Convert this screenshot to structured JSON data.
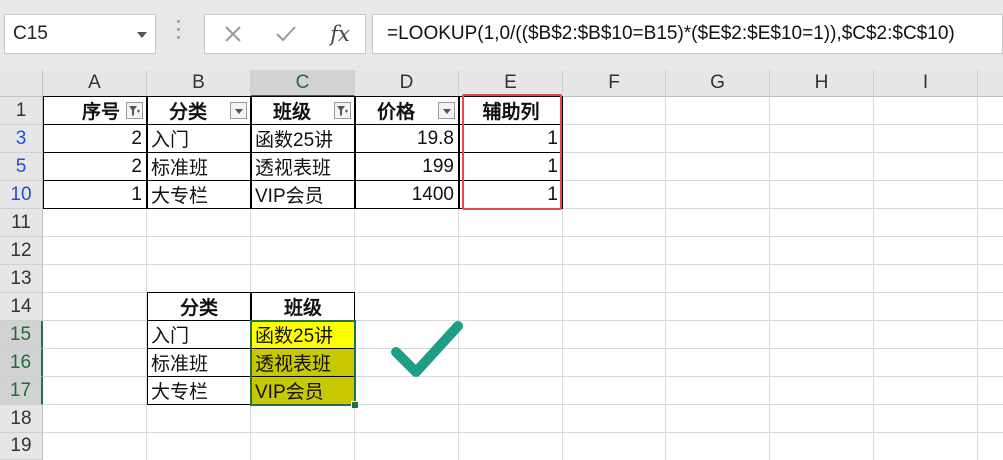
{
  "name_box": {
    "value": "C15"
  },
  "formula_bar": {
    "cancel_icon": "close-icon",
    "enter_icon": "check-icon",
    "fx_label": "fx",
    "formula": "=LOOKUP(1,0/(($B$2:$B$10=B15)*($E$2:$E$10=1)),$C$2:$C$10)"
  },
  "columns": [
    "A",
    "B",
    "C",
    "D",
    "E",
    "F",
    "G",
    "H",
    "I"
  ],
  "rows": [
    "1",
    "3",
    "5",
    "10",
    "11",
    "12",
    "13",
    "14",
    "15",
    "16",
    "17",
    "18",
    "19"
  ],
  "table1": {
    "headers": [
      "序号",
      "分类",
      "班级",
      "价格",
      "辅助列"
    ],
    "rows": [
      [
        "2",
        "入门",
        "函数25讲",
        "19.8",
        "1"
      ],
      [
        "2",
        "标准班",
        "透视表班",
        "199",
        "1"
      ],
      [
        "1",
        "大专栏",
        "VIP会员",
        "1400",
        "1"
      ]
    ]
  },
  "table2": {
    "headers": [
      "分类",
      "班级"
    ],
    "rows": [
      [
        "入门",
        "函数25讲"
      ],
      [
        "标准班",
        "透视表班"
      ],
      [
        "大专栏",
        "VIP会员"
      ]
    ]
  },
  "colors": {
    "highlight_yellow": "#ffff00",
    "highlight_olive": "#c8c800",
    "checkmark": "#1e9e84",
    "red_box": "#e04c4c",
    "excel_green": "#217346",
    "row_number_blue": "#1f4ed8"
  },
  "decorations": {
    "checkmark_icon": "checkmark-icon"
  }
}
